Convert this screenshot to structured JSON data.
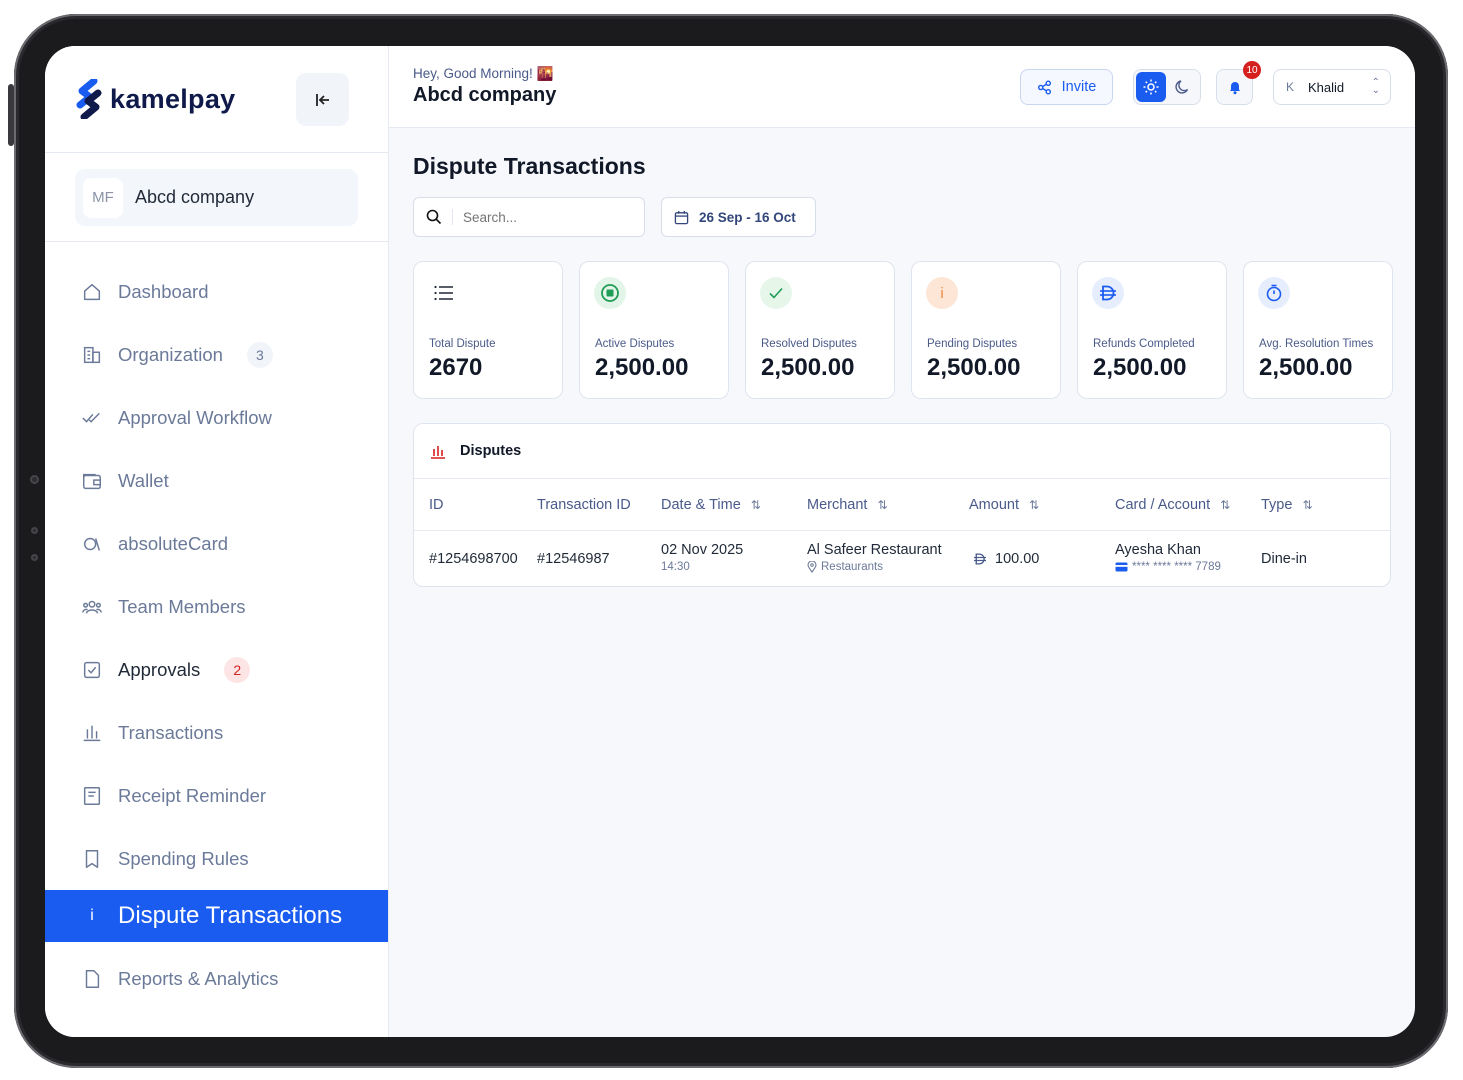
{
  "brand": {
    "logo_text": "kamelpay"
  },
  "organization": {
    "initials": "MF",
    "name": "Abcd company"
  },
  "sidebar": {
    "items": [
      {
        "label": "Dashboard",
        "badge": ""
      },
      {
        "label": "Organization",
        "badge": "3"
      },
      {
        "label": "Approval Workflow",
        "badge": ""
      },
      {
        "label": "Wallet",
        "badge": ""
      },
      {
        "label": "absoluteCard",
        "badge": ""
      },
      {
        "label": "Team Members",
        "badge": ""
      },
      {
        "label": "Approvals",
        "badge": "2"
      },
      {
        "label": "Transactions",
        "badge": ""
      },
      {
        "label": "Receipt Reminder",
        "badge": ""
      },
      {
        "label": "Spending Rules",
        "badge": ""
      },
      {
        "label": "Dispute Transactions",
        "badge": "",
        "active_icon": "i"
      },
      {
        "label": "Reports & Analytics",
        "badge": ""
      }
    ]
  },
  "header": {
    "greeting": "Hey, Good Morning! 🌇",
    "company": "Abcd company",
    "invite_label": "Invite",
    "notifications_count": "10",
    "user_initial": "K",
    "user_name": "Khalid"
  },
  "page": {
    "title": "Dispute Transactions",
    "search_placeholder": "Search...",
    "date_range": "26 Sep - 16 Oct"
  },
  "stats": [
    {
      "label": "Total Dispute",
      "value": "2670",
      "icon": "list-icon"
    },
    {
      "label": "Active Disputes",
      "value": "2,500.00",
      "icon": "stop-circle-icon"
    },
    {
      "label": "Resolved Disputes",
      "value": "2,500.00",
      "icon": "check-icon"
    },
    {
      "label": "Pending Disputes",
      "value": "2,500.00",
      "icon": "info-icon",
      "glyph": "i"
    },
    {
      "label": "Refunds Completed",
      "value": "2,500.00",
      "icon": "dirham-icon"
    },
    {
      "label": "Avg. Resolution Times",
      "value": "2,500.00",
      "icon": "timer-icon"
    }
  ],
  "disputes_table": {
    "title": "Disputes",
    "columns": [
      "ID",
      "Transaction ID",
      "Date & Time",
      "Merchant",
      "Amount",
      "Card / Account",
      "Type"
    ],
    "rows": [
      {
        "id": "#1254698700",
        "transaction_id": "#12546987",
        "date": "02 Nov 2025",
        "time": "14:30",
        "merchant": "Al Safeer Restaurant",
        "merchant_category": "Restaurants",
        "amount": "100.00",
        "card_holder": "Ayesha Khan",
        "card_number": "**** **** **** 7789",
        "type": "Dine-in"
      }
    ]
  },
  "colors": {
    "primary": "#1a5cf0",
    "danger": "#d61f1f",
    "success": "#1f9d55",
    "warning": "#f08a3c"
  }
}
